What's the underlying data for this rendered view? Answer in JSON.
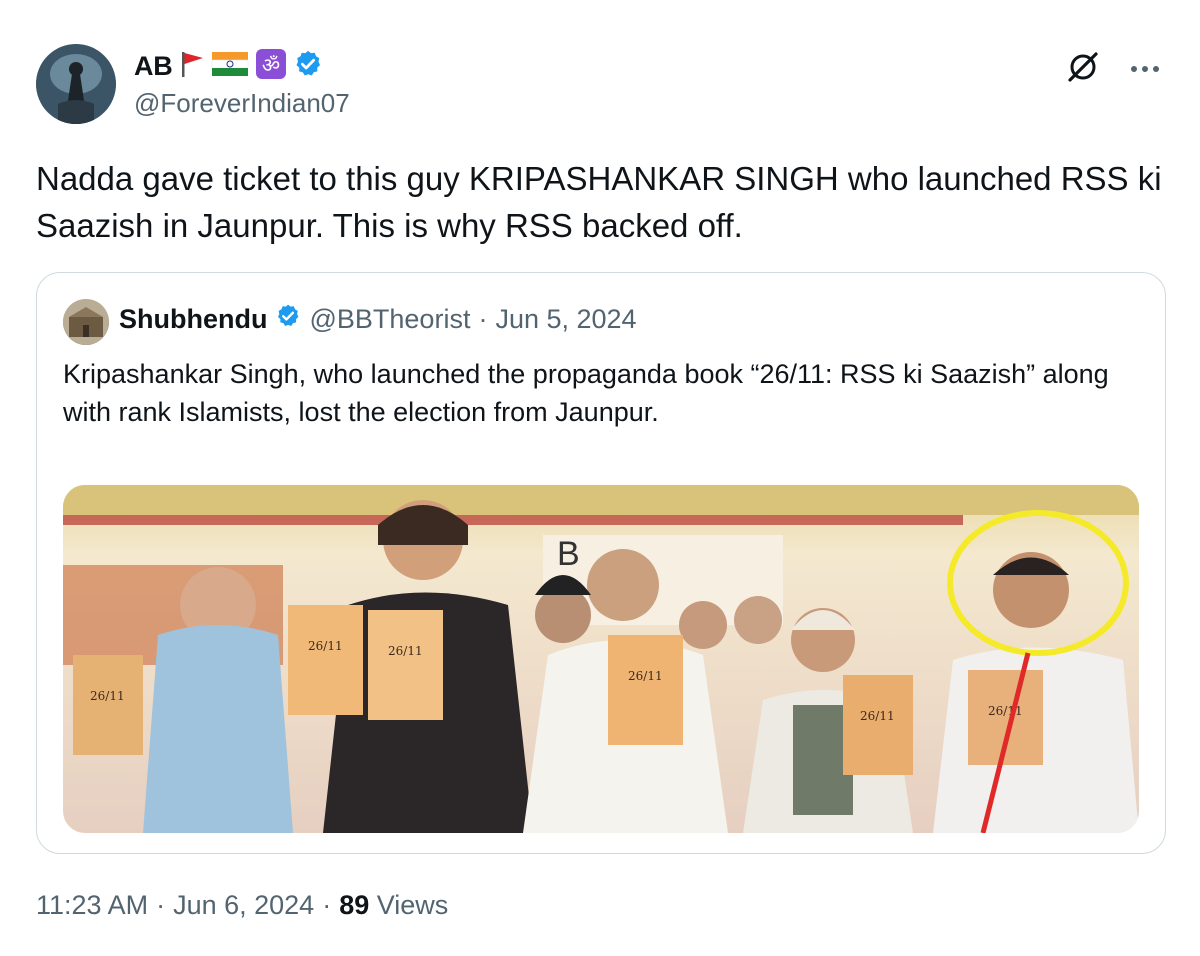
{
  "tweet": {
    "author": {
      "display_name": "AB",
      "handle": "@ForeverIndian07",
      "verified": true,
      "badges": [
        "red-flag-icon",
        "india-flag-icon",
        "om-icon"
      ]
    },
    "text": "Nadda gave ticket to this guy KRIPASHANKAR SINGH who launched RSS ki Saazish in Jaunpur. This is why RSS backed off.",
    "time": "11:23 AM",
    "separator": "·",
    "date": "Jun 6, 2024",
    "views_count": "89",
    "views_label": "Views"
  },
  "quoted": {
    "display_name": "Shubhendu",
    "verified": true,
    "handle": "@BBTheorist",
    "separator": "·",
    "date": "Jun 5, 2024",
    "text": "Kripashankar Singh, who launched the propaganda book “26/11: RSS ki Saazish” along with rank Islamists, lost the election from Jaunpur.",
    "image": {
      "book_label": "26/11",
      "annotation": "yellow circle with red arrow highlighting man on right"
    }
  },
  "icons": [
    "grok-icon",
    "more-icon",
    "verified-badge-icon"
  ],
  "colors": {
    "text": "#0f1419",
    "secondary": "#536471",
    "verified": "#1d9bf0",
    "border": "#cfd9de",
    "highlight_circle": "#f5ea2a",
    "arrow": "#e02a2a"
  }
}
